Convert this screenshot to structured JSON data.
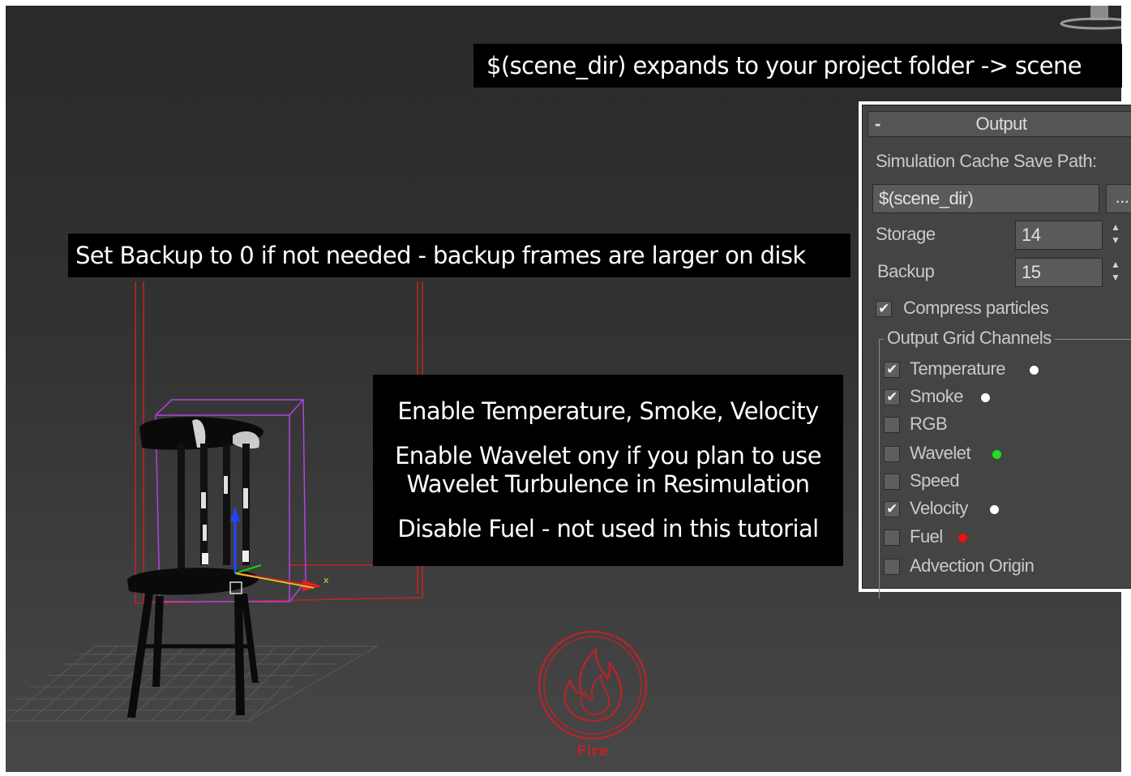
{
  "captions": {
    "scene_dir_note": "$(scene_dir) expands to your project folder -> scene",
    "backup_note": "Set Backup to 0 if not needed - backup frames are larger on disk",
    "channels_note": [
      [
        "Enable Temperature, Smoke, Velocity"
      ],
      [
        "Enable Wavelet ony if you plan to use",
        "Wavelet Turbulence in Resimulation"
      ],
      [
        "Disable Fuel - not used in this tutorial"
      ]
    ]
  },
  "viewport": {
    "gizmo_label": "x",
    "fire_label": "Fire"
  },
  "output_panel": {
    "toggle": "-",
    "title": "Output",
    "cache_path_label": "Simulation Cache Save Path:",
    "cache_path_value": "$(scene_dir)",
    "browse_label": "...",
    "storage_label": "Storage",
    "storage_value": "14",
    "backup_label": "Backup",
    "backup_value": "15",
    "compress_label": "Compress particles",
    "compress_checked": true,
    "grid_group_title": "Output Grid Channels",
    "channels": [
      {
        "label": "Temperature",
        "checked": true,
        "dot": "#ffffff"
      },
      {
        "label": "Smoke",
        "checked": true,
        "dot": "#ffffff"
      },
      {
        "label": "RGB",
        "checked": false,
        "dot": null
      },
      {
        "label": "Wavelet",
        "checked": false,
        "dot": "#22dd22"
      },
      {
        "label": "Speed",
        "checked": false,
        "dot": null
      },
      {
        "label": "Velocity",
        "checked": true,
        "dot": "#ffffff"
      },
      {
        "label": "Fuel",
        "checked": false,
        "dot": "#ee1111"
      },
      {
        "label": "Advection Origin",
        "checked": false,
        "dot": null
      }
    ]
  }
}
